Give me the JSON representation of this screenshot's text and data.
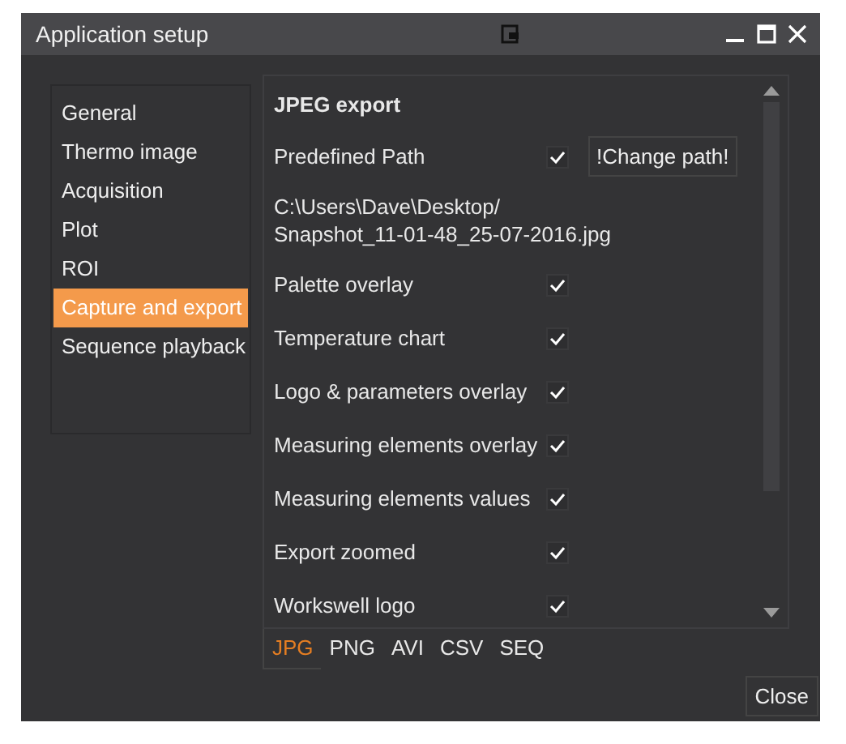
{
  "window": {
    "title": "Application setup"
  },
  "sidebar": {
    "items": [
      {
        "label": "General",
        "selected": false
      },
      {
        "label": "Thermo image",
        "selected": false
      },
      {
        "label": "Acquisition",
        "selected": false
      },
      {
        "label": "Plot",
        "selected": false
      },
      {
        "label": "ROI",
        "selected": false
      },
      {
        "label": "Capture and export",
        "selected": true
      },
      {
        "label": "Sequence playback",
        "selected": false
      }
    ]
  },
  "panel": {
    "heading": "JPEG export",
    "predefined_path": {
      "label": "Predefined Path",
      "checked": true,
      "button": "!Change path!"
    },
    "path_lines": [
      "C:\\Users\\Dave\\Desktop/",
      "Snapshot_11-01-48_25-07-2016.jpg"
    ],
    "options": [
      {
        "label": "Palette overlay",
        "checked": true
      },
      {
        "label": "Temperature chart",
        "checked": true
      },
      {
        "label": "Logo & parameters overlay",
        "checked": true
      },
      {
        "label": "Measuring elements overlay",
        "checked": true
      },
      {
        "label": "Measuring elements values",
        "checked": true
      },
      {
        "label": "Export zoomed",
        "checked": true
      },
      {
        "label": "Workswell logo",
        "checked": true
      }
    ]
  },
  "format_tabs": [
    {
      "label": "JPG",
      "selected": true
    },
    {
      "label": "PNG",
      "selected": false
    },
    {
      "label": "AVI",
      "selected": false
    },
    {
      "label": "CSV",
      "selected": false
    },
    {
      "label": "SEQ",
      "selected": false
    }
  ],
  "close_button": "Close"
}
